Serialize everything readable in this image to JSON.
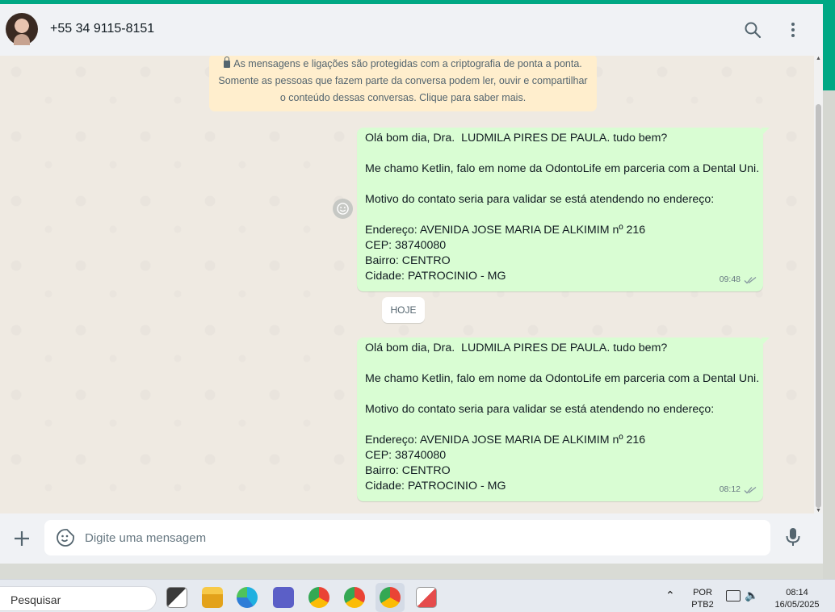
{
  "header": {
    "contact_name": "+55 34 9115-8151",
    "icons": [
      "search-icon",
      "more-vertical-icon"
    ]
  },
  "banner": {
    "lines": [
      "As mensagens e ligações são protegidas com a criptografia de ponta a ponta.",
      "Somente as pessoas que fazem parte da conversa podem ler, ouvir e compartilhar",
      "o conteúdo dessas conversas. Clique para saber mais."
    ]
  },
  "messages": [
    {
      "lines": [
        "Olá bom dia, Dra.  LUDMILA PIRES DE PAULA. tudo bem?",
        "",
        "Me chamo Ketlin, falo em nome da OdontoLife em parceria com a Dental Uni.",
        "",
        "Motivo do contato seria para validar se está atendendo no endereço:",
        "",
        "Endereço: AVENIDA JOSE MARIA DE ALKIMIM nº 216",
        "CEP: 38740080",
        "Bairro: CENTRO",
        "Cidade: PATROCINIO - MG"
      ],
      "time": "09:48"
    },
    {
      "lines": [
        "Olá bom dia, Dra.  LUDMILA PIRES DE PAULA. tudo bem?",
        "",
        "Me chamo Ketlin, falo em nome da OdontoLife em parceria com a Dental Uni.",
        "",
        "Motivo do contato seria para validar se está atendendo no endereço:",
        "",
        "Endereço: AVENIDA JOSE MARIA DE ALKIMIM nº 216",
        "CEP: 38740080",
        "Bairro: CENTRO",
        "Cidade: PATROCINIO - MG"
      ],
      "time": "08:12"
    }
  ],
  "date_separator": "HOJE",
  "composer": {
    "placeholder": "Digite uma mensagem"
  },
  "taskbar": {
    "search_label": "Pesquisar",
    "language_line1": "POR",
    "language_line2": "PTB2",
    "time": "08:14",
    "date": "16/05/2025"
  },
  "colors": {
    "accent": "#00a884",
    "outgoing_bubble": "#d9fdd3",
    "banner": "#ffeecd",
    "chat_bg": "#efeae2"
  }
}
